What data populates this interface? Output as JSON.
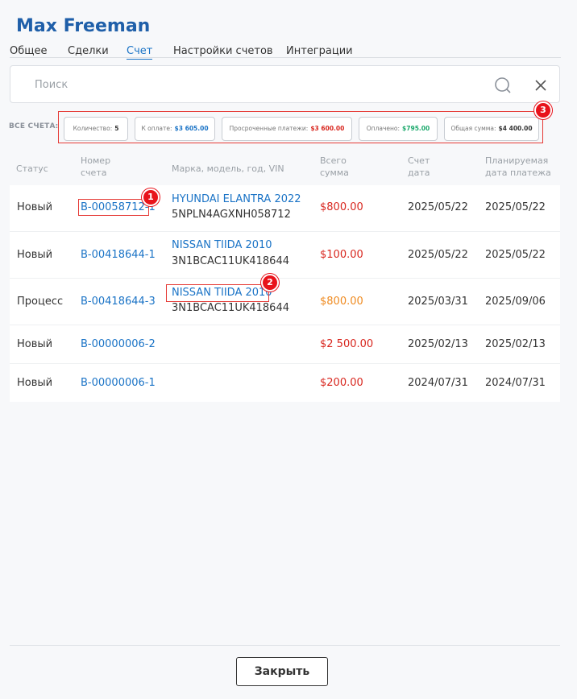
{
  "header": {
    "title": "Max Freeman"
  },
  "tabs": [
    {
      "label": "Общее"
    },
    {
      "label": "Сделки"
    },
    {
      "label": "Счет"
    },
    {
      "label": "Настройки счетов"
    },
    {
      "label": "Интеграции"
    }
  ],
  "search": {
    "placeholder": "Поиск",
    "value": ""
  },
  "summary": {
    "label": "ВСЕ СЧЕТА:",
    "chips": [
      {
        "label": "Количество:",
        "value": "5",
        "color": "#333333"
      },
      {
        "label": "К оплате:",
        "value": "$3 605.00",
        "color": "#1a73c6"
      },
      {
        "label": "Просроченные платежи:",
        "value": "$3 600.00",
        "color": "#d8261e"
      },
      {
        "label": "Оплачено:",
        "value": "$795.00",
        "color": "#1aa86b"
      },
      {
        "label": "Общая сумма:",
        "value": "$4 400.00",
        "color": "#333333"
      }
    ]
  },
  "table": {
    "headers": {
      "status": "Статус",
      "number_1": "Номер",
      "number_2": "счета",
      "vehicle": "Марка, модель, год, VIN",
      "total_1": "Всего",
      "total_2": "сумма",
      "date_1": "Счет",
      "date_2": "дата",
      "planned_1": "Планируемая",
      "planned_2": "дата платежа"
    },
    "rows": [
      {
        "status": "Новый",
        "number": "B-00058712-1",
        "vehicle": "HYUNDAI ELANTRA 2022",
        "vin": "5NPLN4AGXNH058712",
        "amount": "$800.00",
        "amount_color": "#d8261e",
        "date": "2025/05/22",
        "planned": "2025/05/22"
      },
      {
        "status": "Новый",
        "number": "B-00418644-1",
        "vehicle": "NISSAN TIIDA 2010",
        "vin": "3N1BCAC11UK418644",
        "amount": "$100.00",
        "amount_color": "#d8261e",
        "date": "2025/05/22",
        "planned": "2025/05/22"
      },
      {
        "status": "Процесс",
        "number": "B-00418644-3",
        "vehicle": "NISSAN TIIDA 2010",
        "vin": "3N1BCAC11UK418644",
        "amount": "$800.00",
        "amount_color": "#ef8a1f",
        "date": "2025/03/31",
        "planned": "2025/09/06"
      },
      {
        "status": "Новый",
        "number": "B-00000006-2",
        "vehicle": "",
        "vin": "",
        "amount": "$2 500.00",
        "amount_color": "#d8261e",
        "date": "2025/02/13",
        "planned": "2025/02/13"
      },
      {
        "status": "Новый",
        "number": "B-00000006-1",
        "vehicle": "",
        "vin": "",
        "amount": "$200.00",
        "amount_color": "#d8261e",
        "date": "2024/07/31",
        "planned": "2024/07/31"
      }
    ]
  },
  "markers": [
    "1",
    "2",
    "3"
  ],
  "footer": {
    "close_label": "Закрыть"
  }
}
